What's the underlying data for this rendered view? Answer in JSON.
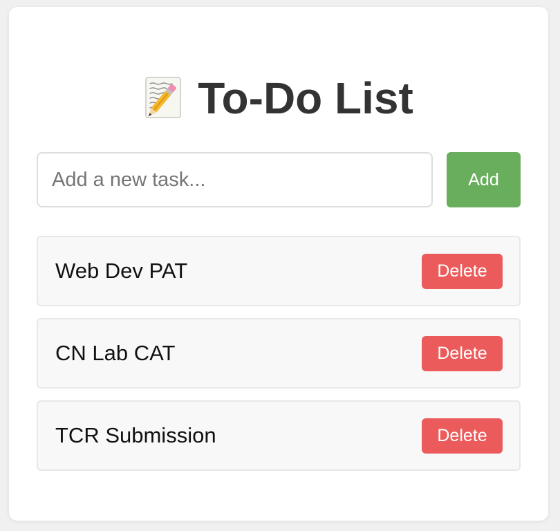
{
  "app": {
    "title": "To-Do List",
    "title_icon": "memo-pencil-icon"
  },
  "new_task": {
    "placeholder": "Add a new task...",
    "value": "",
    "add_label": "Add"
  },
  "tasks": [
    {
      "text": "Web Dev PAT",
      "delete_label": "Delete"
    },
    {
      "text": "CN Lab CAT",
      "delete_label": "Delete"
    },
    {
      "text": "TCR Submission",
      "delete_label": "Delete"
    }
  ],
  "colors": {
    "add_button": "#69ae5c",
    "delete_button": "#ec5b5b",
    "title_text": "#333333"
  }
}
